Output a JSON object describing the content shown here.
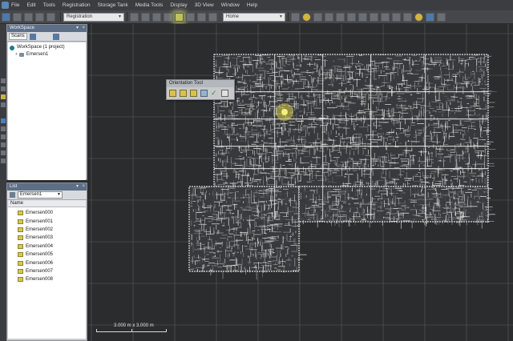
{
  "menu": {
    "items": [
      "File",
      "Edit",
      "Tools",
      "Registration",
      "Storage Tank",
      "Media Tools",
      "Display",
      "3D View",
      "Window",
      "Help"
    ]
  },
  "toolbar": {
    "mode_combo": "Registration",
    "view_combo": "Home"
  },
  "workspace": {
    "title": "WorkSpace",
    "tab_label": "Scans",
    "root_label": "WorkSpace (1 project)",
    "project_label": "Emersen1"
  },
  "list": {
    "title": "List",
    "selected_project": "Emersen1",
    "column_header": "Name",
    "scans": [
      "Emersen000",
      "Emersen001",
      "Emersen002",
      "Emersen003",
      "Emersen004",
      "Emersen005",
      "Emersen006",
      "Emersen007",
      "Emersen008"
    ]
  },
  "orientation_tool": {
    "title": "Orientation Tool"
  },
  "scale_bar": {
    "label": "3.000 m x 3.000 m"
  },
  "colors": {
    "viewport_bg": "#2b2c2e",
    "grid_line": "#5a5c60",
    "highlight": "#d8d248",
    "panel_title": "#5d6f86"
  },
  "icons": {
    "scan_icon": "scan-folder-icon",
    "project_icon": "point-cloud-icon",
    "tool_confirm": "checkmark-icon"
  }
}
